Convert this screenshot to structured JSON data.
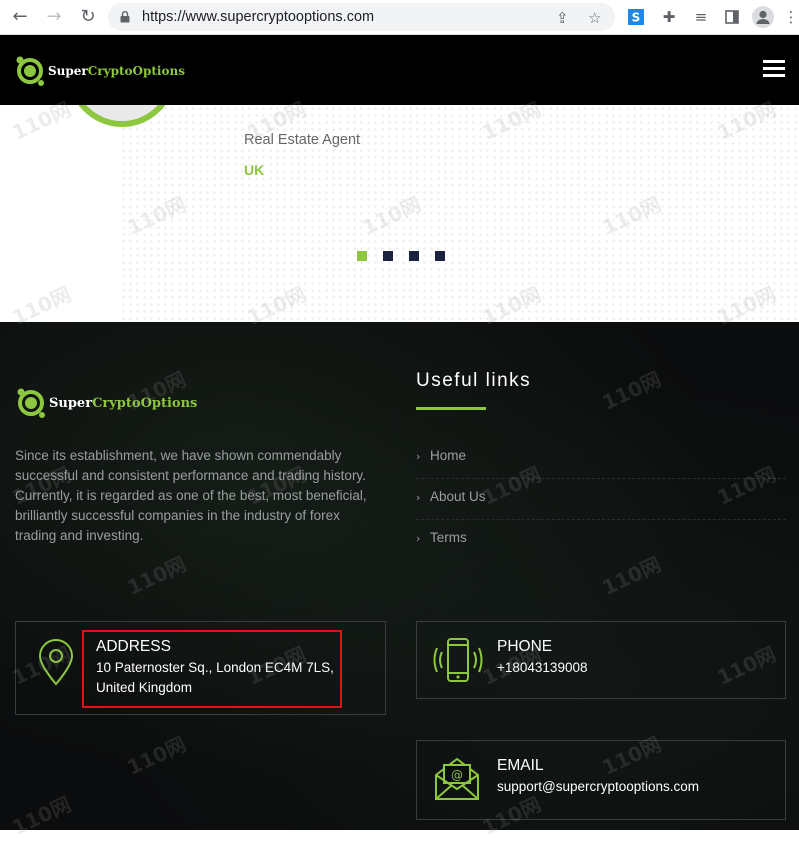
{
  "browser": {
    "url": "https://www.supercryptooptions.com",
    "back_icon": "back-arrow-icon",
    "forward_icon": "forward-arrow-icon",
    "reload_icon": "reload-icon"
  },
  "brand": {
    "name_part1": "Super",
    "name_part2": "CryptoOptions",
    "accent_color": "#8dc63f"
  },
  "testimonial": {
    "role": "Real Estate Agent",
    "country": "UK",
    "slides": 4,
    "active_slide": 1
  },
  "footer": {
    "about": "Since its establishment, we have shown commendably successful and consistent performance and trading history. Currently, it is regarded as one of the best, most beneficial, brilliantly successful companies in the industry of forex trading and investing.",
    "useful_links_title": "Useful links",
    "links": [
      {
        "label": "Home"
      },
      {
        "label": "About Us"
      },
      {
        "label": "Terms"
      }
    ],
    "address": {
      "title": "ADDRESS",
      "line1": "10 Paternoster Sq., London EC4M 7LS,",
      "line2": "United Kingdom"
    },
    "phone": {
      "title": "PHONE",
      "value": "+18043139008"
    },
    "email": {
      "title": "EMAIL",
      "value": "support@supercryptooptions.com"
    }
  },
  "watermark": "110网"
}
